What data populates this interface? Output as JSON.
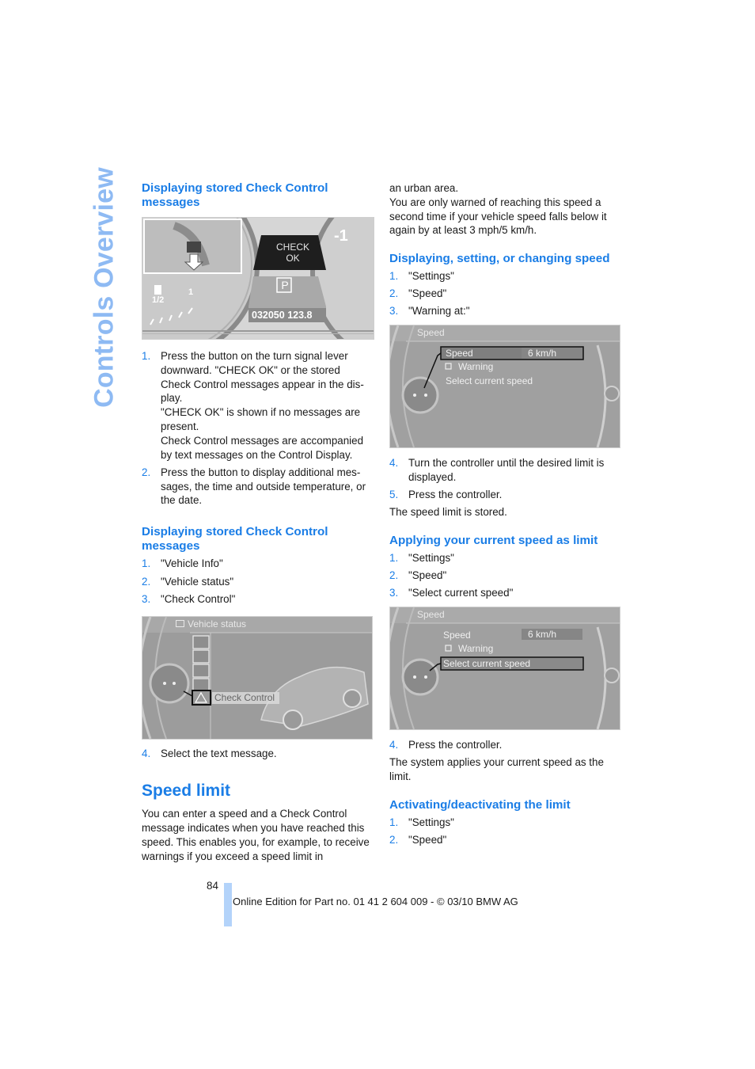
{
  "page": {
    "side_title": "Controls Overview",
    "page_number": "84",
    "footer": "Online Edition for Part no. 01 41 2 604 009 - © 03/10 BMW AG",
    "accent_color": "#1a7de6",
    "side_title_color": "#8ebaf3"
  },
  "left": {
    "section1": {
      "heading": "Displaying stored Check Control messages",
      "figure": {
        "check_label_line1": "CHECK",
        "check_label_line2": "OK",
        "park_symbol": "P",
        "odometer": "032050",
        "trip": "123.8",
        "fuel_half": "1/2",
        "fuel_full": "1",
        "gauge_right_label": "-1"
      },
      "steps": [
        {
          "num": "1.",
          "text": "Press the button on the turn signal lever downward. \"CHECK OK\" or the stored Check Control messages appear in the dis-play.",
          "extra": [
            "\"CHECK OK\" is shown if no messages are present.",
            "Check Control messages are accompanied by text messages on the Control Display."
          ]
        },
        {
          "num": "2.",
          "text": "Press the button to display additional mes-sages, the time and outside temperature, or the date."
        }
      ]
    },
    "section2": {
      "heading": "Displaying stored Check Control messages",
      "steps": [
        {
          "num": "1.",
          "text": "\"Vehicle Info\""
        },
        {
          "num": "2.",
          "text": "\"Vehicle status\""
        },
        {
          "num": "3.",
          "text": "\"Check Control\""
        }
      ],
      "figure": {
        "title": "Vehicle status",
        "selected_item": "Check Control"
      },
      "steps_after": [
        {
          "num": "4.",
          "text": "Select the text message."
        }
      ]
    },
    "speed_limit": {
      "heading": "Speed limit",
      "intro": "You can enter a speed and a Check Control message indicates when you have reached this speed. This enables you, for example, to receive warnings if you exceed a speed limit in"
    }
  },
  "right": {
    "intro_cont": "an urban area.",
    "intro_note": "You are only warned of reaching this speed a second time if your vehicle speed falls below it again by at least 3 mph/5 km/h.",
    "section_set": {
      "heading": "Displaying, setting, or changing speed",
      "steps": [
        {
          "num": "1.",
          "text": "\"Settings\""
        },
        {
          "num": "2.",
          "text": "\"Speed\""
        },
        {
          "num": "3.",
          "text": "\"Warning at:\""
        }
      ],
      "figure": {
        "title": "Speed",
        "row_speed": "Speed",
        "row_speed_value": "6 km/h",
        "row_warning": "Warning",
        "row_select": "Select current speed",
        "highlighted": "Speed"
      },
      "steps_after": [
        {
          "num": "4.",
          "text": "Turn the controller until the desired limit is displayed."
        },
        {
          "num": "5.",
          "text": "Press the controller."
        }
      ],
      "result": "The speed limit is stored."
    },
    "section_apply": {
      "heading": "Applying your current speed as limit",
      "steps": [
        {
          "num": "1.",
          "text": "\"Settings\""
        },
        {
          "num": "2.",
          "text": "\"Speed\""
        },
        {
          "num": "3.",
          "text": "\"Select current speed\""
        }
      ],
      "figure": {
        "title": "Speed",
        "row_speed": "Speed",
        "row_speed_value": "6 km/h",
        "row_warning": "Warning",
        "row_select": "Select current speed",
        "highlighted": "Select current speed"
      },
      "steps_after": [
        {
          "num": "4.",
          "text": "Press the controller."
        }
      ],
      "result": "The system applies your current speed as the limit."
    },
    "section_activate": {
      "heading": "Activating/deactivating the limit",
      "steps": [
        {
          "num": "1.",
          "text": "\"Settings\""
        },
        {
          "num": "2.",
          "text": "\"Speed\""
        }
      ]
    }
  }
}
